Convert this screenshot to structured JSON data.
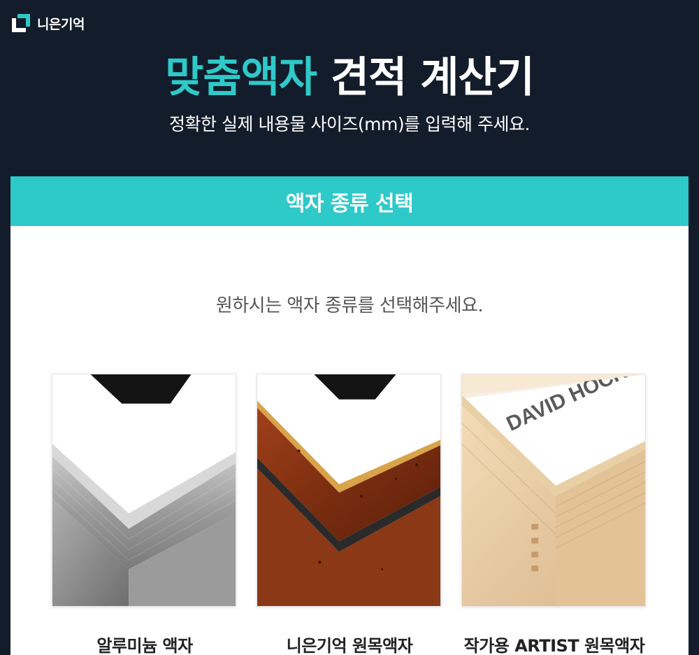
{
  "brand": {
    "name": "니은기억",
    "logo_icon": "frame-corner-logo-icon"
  },
  "header": {
    "title_accent": "맞춤액자",
    "title_rest": "견적 계산기",
    "subtitle": "정확한 실제 내용물 사이즈(mm)를 입력해 주세요."
  },
  "section": {
    "heading": "액자 종류 선택",
    "instruction": "원하시는 액자 종류를 선택해주세요."
  },
  "frames": [
    {
      "label": "알루미늄 액자",
      "image": "aluminum-frame-corner"
    },
    {
      "label": "니은기억 원목액자",
      "image": "wood-frame-corner"
    },
    {
      "label": "작가용 ARTIST 원목액자",
      "image": "artist-wood-frame-corner",
      "image_text": "DAVID HOCKN"
    }
  ],
  "colors": {
    "background": "#131c2a",
    "accent": "#2ec9c9",
    "panel": "#ffffff"
  }
}
